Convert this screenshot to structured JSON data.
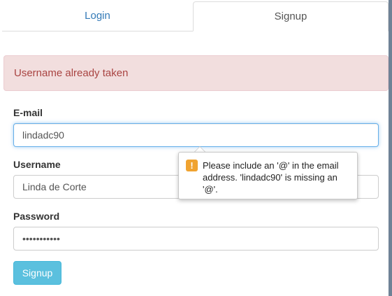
{
  "tabs": {
    "login": "Login",
    "signup": "Signup"
  },
  "alert": {
    "text": "Username already taken"
  },
  "fields": {
    "email": {
      "label": "E-mail",
      "value": "lindadc90"
    },
    "username": {
      "label": "Username",
      "value": "Linda de Corte"
    },
    "password": {
      "label": "Password",
      "value": "•••••••••••"
    }
  },
  "submit_label": "Signup",
  "tooltip": {
    "icon": "warning-icon",
    "text": "Please include an '@' in the email address. 'lindadc90' is missing an '@'.",
    "icon_char": "!"
  },
  "colors": {
    "accent": "#337ab7",
    "alert_bg": "#f2dede",
    "alert_text": "#a94442",
    "button": "#5bc0de",
    "warning": "#f0a330"
  }
}
